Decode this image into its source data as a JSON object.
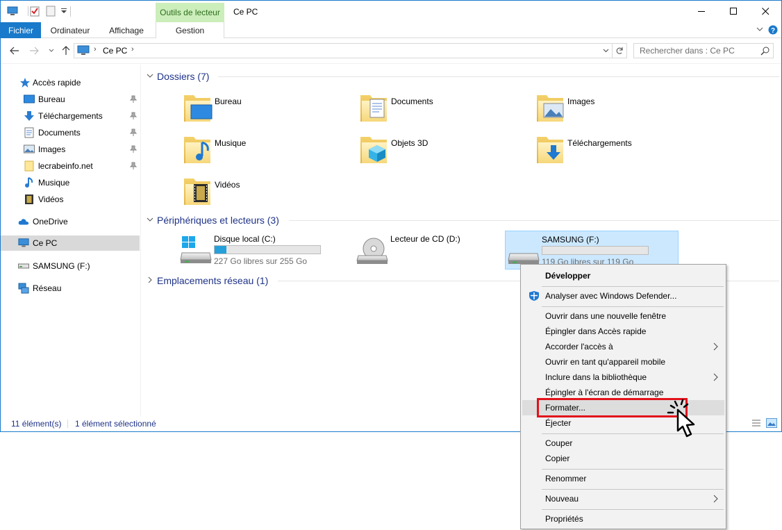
{
  "window": {
    "title": "Ce PC",
    "context_tab_header": "Outils de lecteur",
    "controls": [
      "minimize",
      "maximize",
      "close"
    ]
  },
  "ribbon": {
    "tabs": [
      {
        "label": "Fichier"
      },
      {
        "label": "Ordinateur"
      },
      {
        "label": "Affichage"
      },
      {
        "label": "Gestion"
      }
    ]
  },
  "address_bar": {
    "location": "Ce PC",
    "search_placeholder": "Rechercher dans : Ce PC"
  },
  "nav_pane": {
    "quick_access": "Accès rapide",
    "items": [
      {
        "label": "Bureau",
        "icon": "desktop-icon",
        "pinned": true
      },
      {
        "label": "Téléchargements",
        "icon": "download-icon",
        "pinned": true
      },
      {
        "label": "Documents",
        "icon": "document-icon",
        "pinned": true
      },
      {
        "label": "Images",
        "icon": "picture-icon",
        "pinned": true
      },
      {
        "label": "lecrabeinfo.net",
        "icon": "folder-icon",
        "pinned": true
      },
      {
        "label": "Musique",
        "icon": "music-icon",
        "pinned": false
      },
      {
        "label": "Vidéos",
        "icon": "video-icon",
        "pinned": false
      }
    ],
    "onedrive": "OneDrive",
    "this_pc": "Ce PC",
    "usb": "SAMSUNG (F:)",
    "network": "Réseau"
  },
  "groups": {
    "folders_title": "Dossiers (7)",
    "devices_title": "Périphériques et lecteurs (3)",
    "network_title": "Emplacements réseau (1)"
  },
  "folders": [
    {
      "label": "Bureau",
      "overlay": "desktop"
    },
    {
      "label": "Documents",
      "overlay": "document"
    },
    {
      "label": "Images",
      "overlay": "picture"
    },
    {
      "label": "Musique",
      "overlay": "music"
    },
    {
      "label": "Objets 3D",
      "overlay": "cube"
    },
    {
      "label": "Téléchargements",
      "overlay": "download"
    },
    {
      "label": "Vidéos",
      "overlay": "video"
    }
  ],
  "drives": [
    {
      "label": "Disque local (C:)",
      "free": "227 Go libres sur 255 Go",
      "used_fraction": 0.11,
      "selected": false,
      "kind": "windows"
    },
    {
      "label": "Lecteur de CD (D:)",
      "free": "",
      "used_fraction": null,
      "selected": false,
      "kind": "cd"
    },
    {
      "label": "SAMSUNG (F:)",
      "free": "119 Go libres sur 119 Go",
      "used_fraction": 0.0,
      "selected": true,
      "kind": "usb"
    }
  ],
  "status": {
    "count": "11 élément(s)",
    "selection": "1 élément sélectionné"
  },
  "context_menu": {
    "items": [
      {
        "label": "Développer"
      },
      {
        "label": "Analyser avec Windows Defender..."
      },
      {
        "label": "Ouvrir dans une nouvelle fenêtre"
      },
      {
        "label": "Épingler dans Accès rapide"
      },
      {
        "label": "Accorder l'accès à"
      },
      {
        "label": "Ouvrir en tant qu'appareil mobile"
      },
      {
        "label": "Inclure dans la bibliothèque"
      },
      {
        "label": "Épingler à l'écran de démarrage"
      },
      {
        "label": "Formater..."
      },
      {
        "label": "Éjecter"
      },
      {
        "label": "Couper"
      },
      {
        "label": "Copier"
      },
      {
        "label": "Renommer"
      },
      {
        "label": "Nouveau"
      },
      {
        "label": "Propriétés"
      }
    ],
    "highlighted": "Formater...",
    "highlight_color": "#e2121b"
  },
  "colors": {
    "accent": "#1979ca",
    "selection": "#cce8ff",
    "group_title": "#1e3287",
    "drive_bar": "#26a0da"
  }
}
